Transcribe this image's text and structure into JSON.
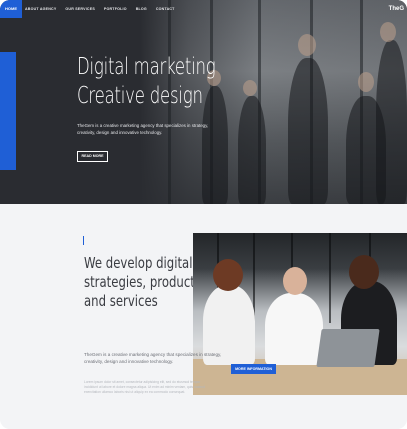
{
  "nav": {
    "logo": "HOME",
    "items": [
      "ABOUT AGENCY",
      "OUR SERVICES",
      "PORTFOLIO",
      "BLOG",
      "CONTACT"
    ],
    "brand": "TheG"
  },
  "hero": {
    "title_line1": "Digital marketing",
    "title_line2": "Creative design",
    "description": "TheGem is a creative marketing agency that specializes in strategy, creativity, design and innovative technology.",
    "button": "READ MORE"
  },
  "about": {
    "title_line1": "We develop digital",
    "title_line2": "strategies, products",
    "title_line3": "and services",
    "description": "TheGem is a creative marketing agency that specializes in strategy, creativity, design and innovative technology.",
    "lorem": "Lorem ipsum dolor sit amet, consectetur adipisicing elit, sed do eiusmod tempor incididunt ut labore et dolore magna aliqua. Ut enim ad minim veniam, quis nostrud exercitation ullamco laboris nisi ut aliquip ex ea commodo consequat.",
    "button": "MORE INFORMATION"
  },
  "colors": {
    "accent": "#1f5fd6",
    "hero_bg": "#2a2c31"
  }
}
